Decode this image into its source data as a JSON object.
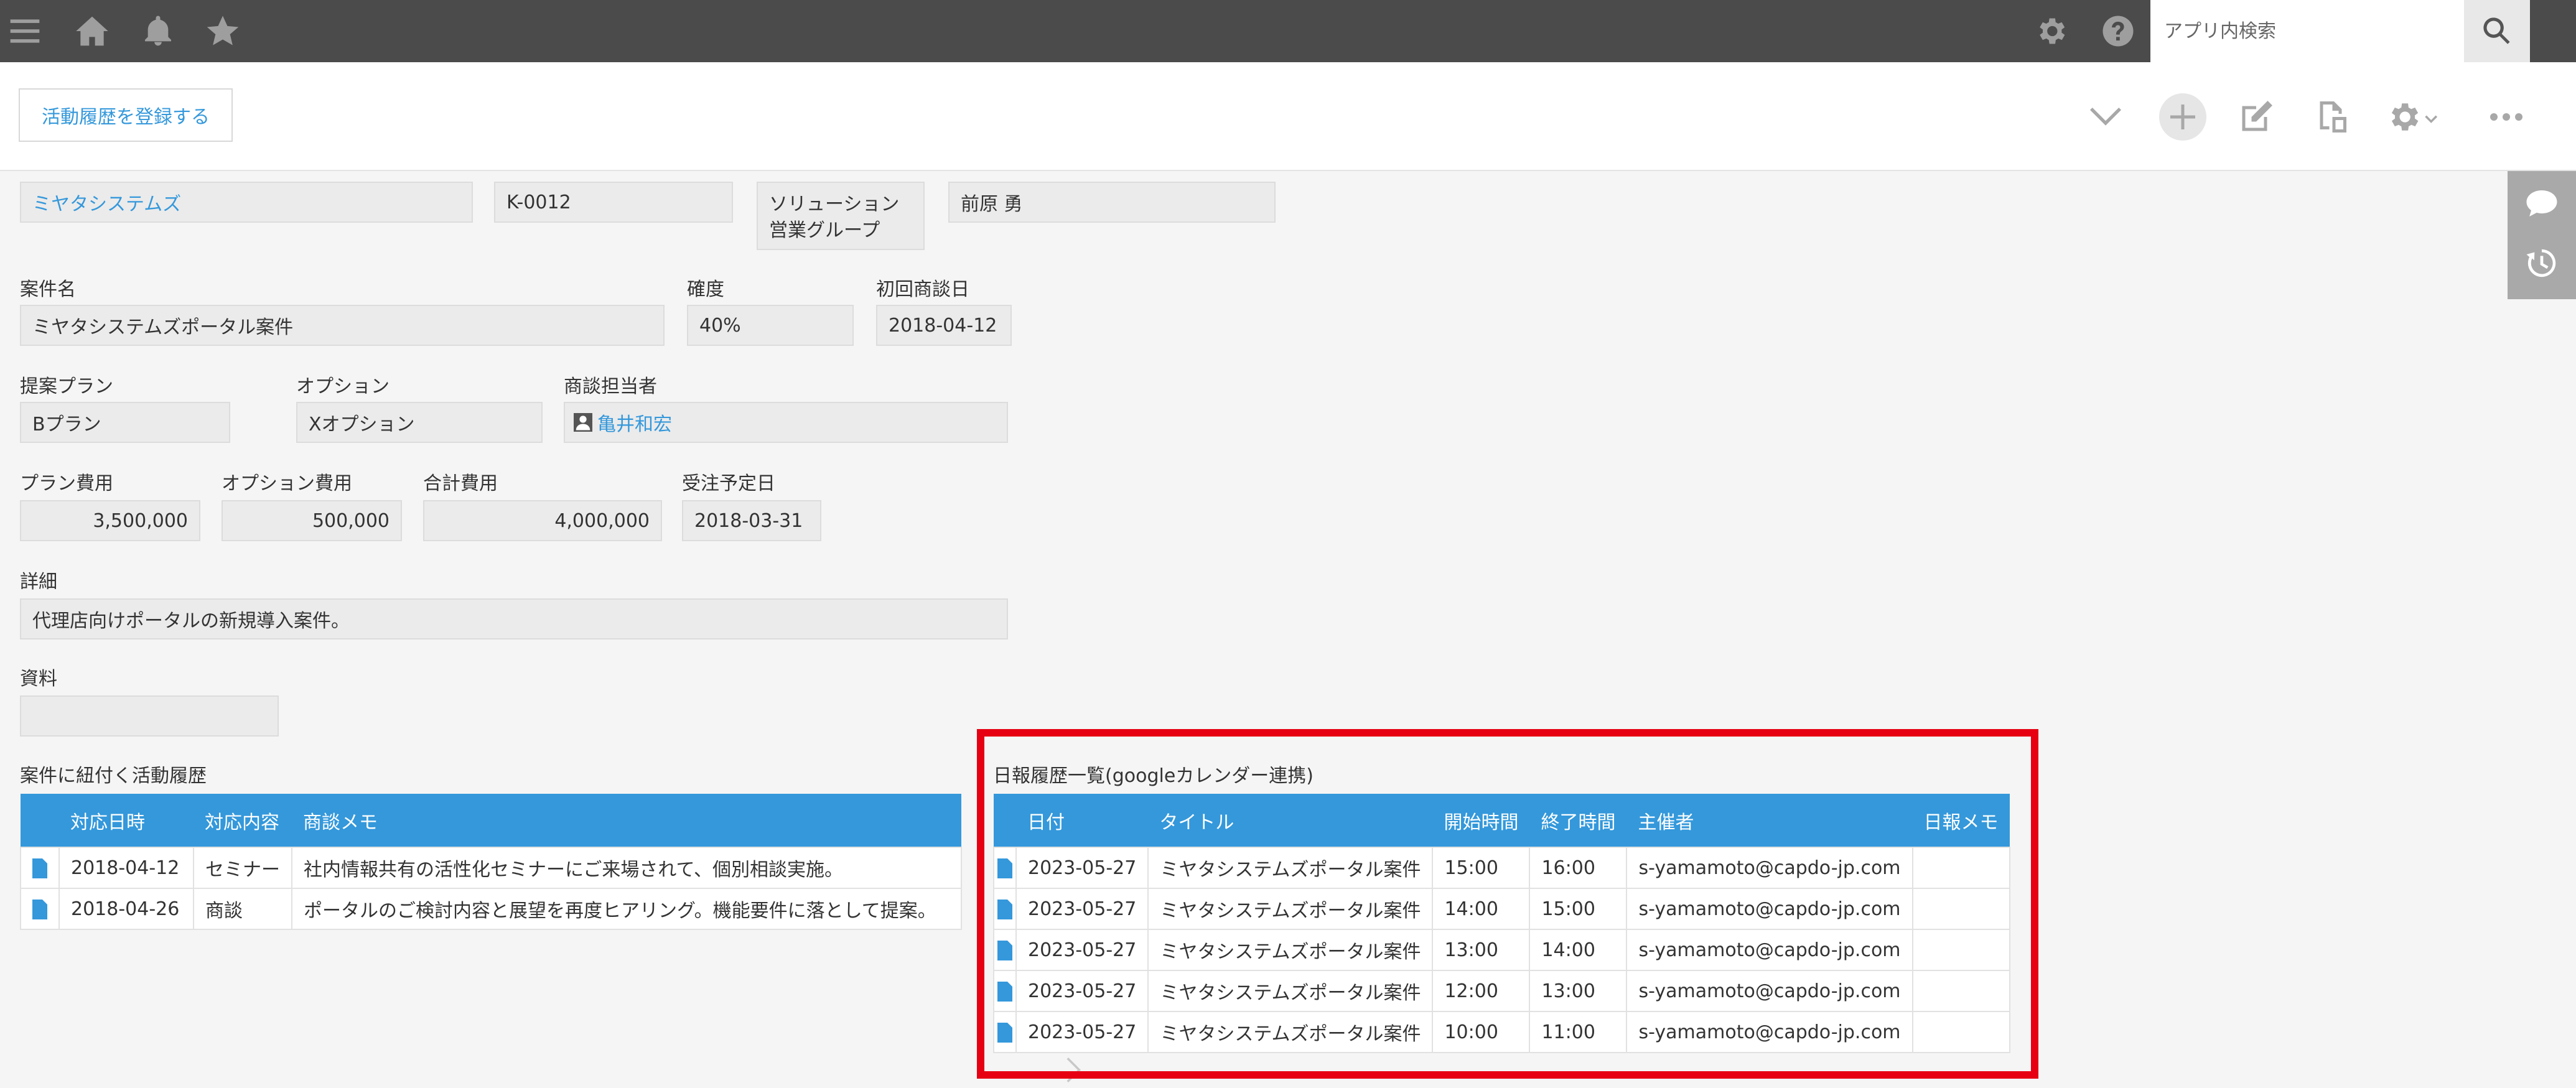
{
  "header": {
    "search_placeholder": "アプリ内検索",
    "icons": [
      "menu-icon",
      "home-icon",
      "bell-icon",
      "star-icon",
      "gear-icon",
      "help-icon",
      "search-icon"
    ]
  },
  "toolbar": {
    "register_label": "活動履歴を登録する",
    "icons": [
      "chevron-down-icon",
      "plus-icon",
      "edit-icon",
      "copy-icon",
      "gear-icon",
      "more-icon"
    ]
  },
  "record": {
    "company": "ミヤタシステムズ",
    "code": "K-0012",
    "group": "ソリューション営業グループ",
    "owner": "前原 勇",
    "case_name_label": "案件名",
    "case_name": "ミヤタシステムズポータル案件",
    "probability_label": "確度",
    "probability": "40%",
    "first_meeting_label": "初回商談日",
    "first_meeting": "2018-04-12",
    "plan_label": "提案プラン",
    "plan": "Bプラン",
    "option_label": "オプション",
    "option": "Xオプション",
    "rep_label": "商談担当者",
    "rep": "亀井和宏",
    "plan_cost_label": "プラン費用",
    "plan_cost": "3,500,000",
    "option_cost_label": "オプション費用",
    "option_cost": "500,000",
    "total_cost_label": "合計費用",
    "total_cost": "4,000,000",
    "order_date_label": "受注予定日",
    "order_date": "2018-03-31",
    "detail_label": "詳細",
    "detail": "代理店向けポータルの新規導入案件。",
    "materials_label": "資料",
    "materials": ""
  },
  "activity": {
    "title": "案件に紐付く活動履歴",
    "columns": [
      "対応日時",
      "対応内容",
      "商談メモ"
    ],
    "rows": [
      [
        "2018-04-12",
        "セミナー",
        "社内情報共有の活性化セミナーにご来場されて、個別相談実施。"
      ],
      [
        "2018-04-26",
        "商談",
        "ポータルのご検討内容と展望を再度ヒアリング。機能要件に落として提案。"
      ]
    ]
  },
  "daily": {
    "title": "日報履歴一覧(googleカレンダー連携)",
    "columns": [
      "日付",
      "タイトル",
      "開始時間",
      "終了時間",
      "主催者",
      "日報メモ"
    ],
    "rows": [
      [
        "2023-05-27",
        "ミヤタシステムズポータル案件",
        "15:00",
        "16:00",
        "s-yamamoto@capdo-jp.com",
        ""
      ],
      [
        "2023-05-27",
        "ミヤタシステムズポータル案件",
        "14:00",
        "15:00",
        "s-yamamoto@capdo-jp.com",
        ""
      ],
      [
        "2023-05-27",
        "ミヤタシステムズポータル案件",
        "13:00",
        "14:00",
        "s-yamamoto@capdo-jp.com",
        ""
      ],
      [
        "2023-05-27",
        "ミヤタシステムズポータル案件",
        "12:00",
        "13:00",
        "s-yamamoto@capdo-jp.com",
        ""
      ],
      [
        "2023-05-27",
        "ミヤタシステムズポータル案件",
        "10:00",
        "11:00",
        "s-yamamoto@capdo-jp.com",
        ""
      ]
    ]
  },
  "colors": {
    "topbar": "#4b4b4b",
    "accent": "#3498db",
    "highlight": "#e60012"
  }
}
